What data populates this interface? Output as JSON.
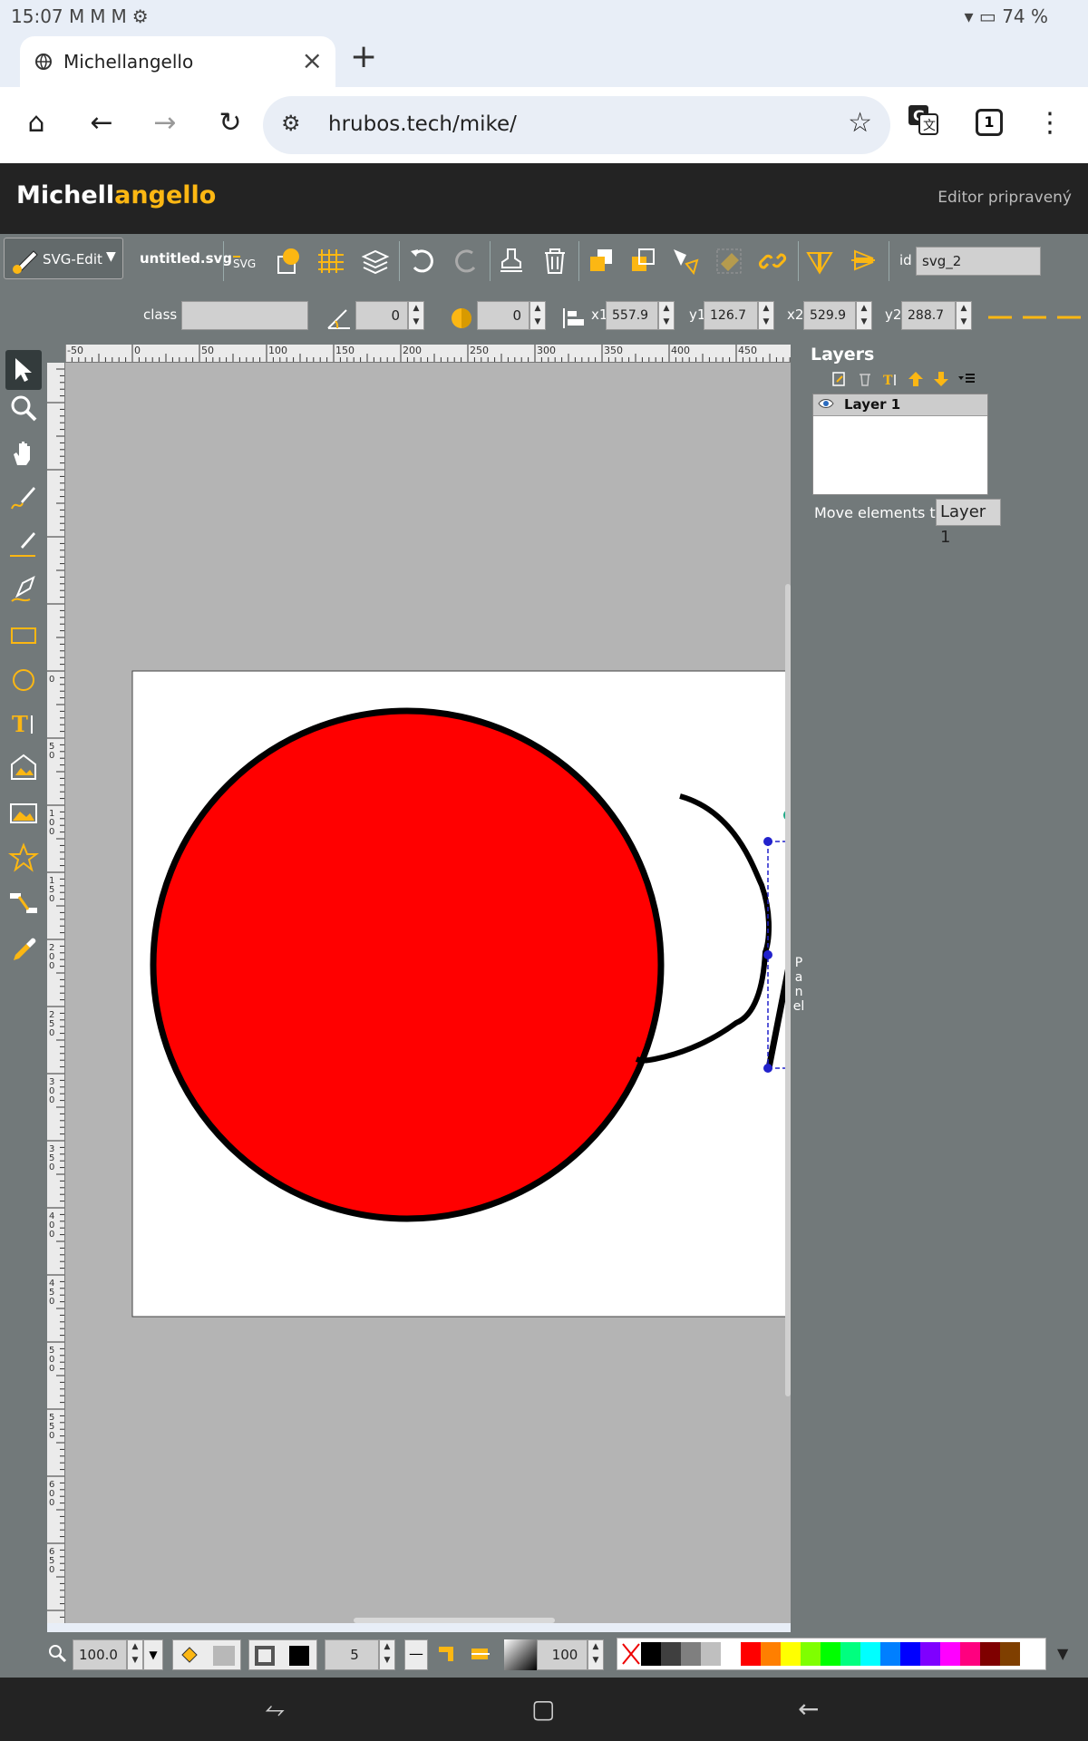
{
  "status_bar": {
    "time": "15:07",
    "notification_icons": [
      "gmail-icon",
      "gmail-icon",
      "gmail-icon",
      "settings-icon"
    ],
    "battery": "74 %"
  },
  "browser": {
    "tab_title": "Michellangello",
    "url": "hrubos.tech/mike/",
    "tab_count": "1"
  },
  "app": {
    "logo_part1": "Michell",
    "logo_part2": "angello",
    "status": "Editor pripravený",
    "accent_color": "#fcb713"
  },
  "toolbar": {
    "brand_label": "SVG-Edit",
    "filename": "untitled.svg",
    "svg_label": "SVG",
    "id_label": "id",
    "id_value": "svg_2",
    "class_label": "class",
    "class_value": "",
    "angle_value": "0",
    "blur_value": "0",
    "x1_label": "x1",
    "x1_value": "557.9",
    "y1_label": "y1",
    "y1_value": "126.7",
    "x2_label": "x2",
    "x2_value": "529.9",
    "y2_label": "y2",
    "y2_value": "288.7"
  },
  "rulers": {
    "top_ticks": [
      "-50",
      "0",
      "50",
      "100",
      "150",
      "200",
      "250",
      "300",
      "350",
      "400",
      "450"
    ],
    "left_ticks": [
      "0",
      "50",
      "100",
      "150",
      "200",
      "250",
      "300",
      "350",
      "400",
      "450",
      "500",
      "550",
      "600",
      "650"
    ]
  },
  "layers_panel": {
    "title": "Layers",
    "layers": [
      {
        "name": "Layer 1"
      }
    ],
    "move_label": "Move elements to:",
    "move_value": "Layer 1",
    "side_tab": "Panel"
  },
  "bottom_bar": {
    "zoom": "100.0",
    "stroke_width": "5",
    "opacity": "100",
    "palette": [
      "#000000",
      "#3f3f3f",
      "#7f7f7f",
      "#bfbfbf",
      "#ffffff",
      "#ff0000",
      "#ff7f00",
      "#ffff00",
      "#7fff00",
      "#00ff00",
      "#00ff7f",
      "#00ffff",
      "#007fff",
      "#0000ff",
      "#7f00ff",
      "#ff00ff",
      "#ff007f",
      "#7f0000",
      "#7f3f00"
    ]
  },
  "canvas": {
    "circle_fill": "#ff0000",
    "stroke_color": "#000000",
    "selection_color": "#2222cc"
  }
}
